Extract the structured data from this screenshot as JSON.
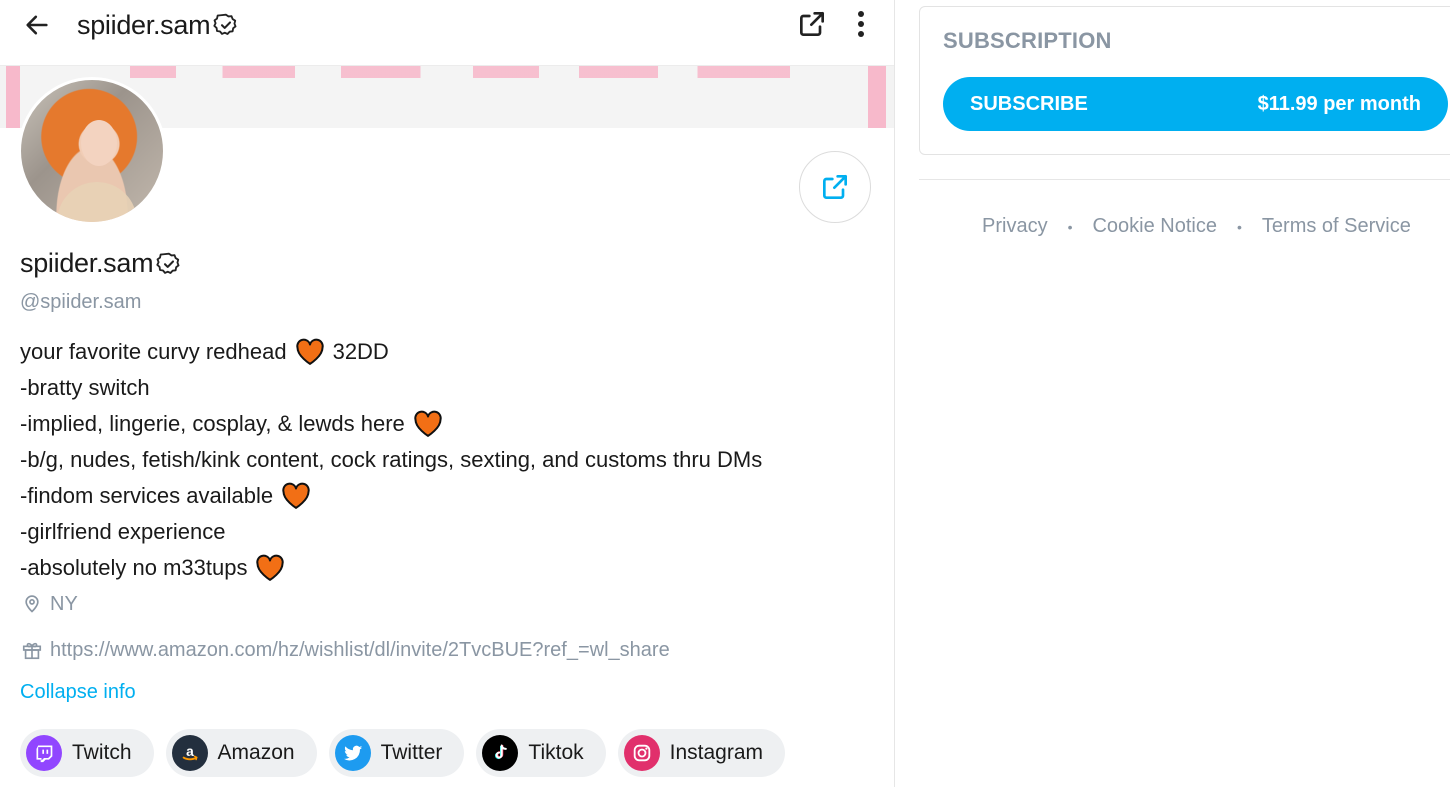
{
  "header": {
    "title": "spiider.sam",
    "back_icon": "arrow-left-icon",
    "share_icon": "share-icon",
    "more_icon": "more-vertical-icon"
  },
  "profile": {
    "display_name": "spiider.sam",
    "handle": "@spiider.sam",
    "verified": true,
    "bio_lines": [
      {
        "text": "your favorite curvy redhead",
        "heart": true,
        "suffix": "32DD"
      },
      {
        "text": "-bratty switch",
        "heart": false,
        "suffix": ""
      },
      {
        "text": "-implied, lingerie, cosplay, & lewds here",
        "heart": true,
        "suffix": ""
      },
      {
        "text": "-b/g, nudes, fetish/kink content, cock ratings, sexting, and customs thru DMs",
        "heart": false,
        "suffix": ""
      },
      {
        "text": "-findom services available",
        "heart": true,
        "suffix": ""
      },
      {
        "text": "-girlfriend experience",
        "heart": false,
        "suffix": ""
      },
      {
        "text": "-absolutely no m33tups",
        "heart": true,
        "suffix": ""
      }
    ],
    "location": "NY",
    "wishlist_url": "https://www.amazon.com/hz/wishlist/dl/invite/2TvcBUE?ref_=wl_share",
    "collapse_label": "Collapse info"
  },
  "social_links": [
    {
      "label": "Twitch",
      "icon": "twitch-icon",
      "color": "#9146ff"
    },
    {
      "label": "Amazon",
      "icon": "amazon-icon",
      "color": "#232f3e"
    },
    {
      "label": "Twitter",
      "icon": "twitter-icon",
      "color": "#1d9bf0"
    },
    {
      "label": "Tiktok",
      "icon": "tiktok-icon",
      "color": "#000000"
    },
    {
      "label": "Instagram",
      "icon": "instagram-icon",
      "color": "#e1306c"
    }
  ],
  "subscription": {
    "title": "SUBSCRIPTION",
    "button_label": "SUBSCRIBE",
    "price": "$11.99 per month",
    "accent": "#00aff0"
  },
  "footer": {
    "privacy": "Privacy",
    "cookie": "Cookie Notice",
    "terms": "Terms of Service",
    "separator": "•"
  }
}
